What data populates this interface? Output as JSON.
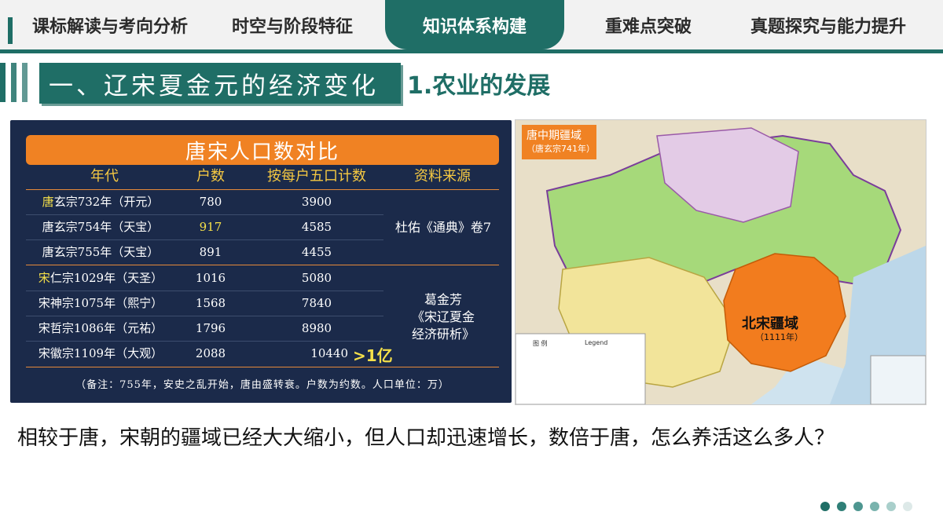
{
  "nav": {
    "tabs": [
      "课标解读与考向分析",
      "时空与阶段特征",
      "知识体系构建",
      "重难点突破",
      "真题探究与能力提升"
    ],
    "active_index": 2,
    "accent": "#1f6e66"
  },
  "section": {
    "heading": "一、辽宋夏金元的经济变化",
    "subheading": "1.农业的发展"
  },
  "table": {
    "title": "唐宋人口数对比",
    "headers": [
      "年代",
      "户数",
      "按每户五口计数",
      "资料来源"
    ],
    "rows": [
      {
        "era_prefix": "唐",
        "era_rest": "玄宗732年（开元）",
        "households": "780",
        "population": "3900"
      },
      {
        "era_prefix": "",
        "era_rest": "唐玄宗754年（天宝）",
        "households": "917",
        "population": "4585"
      },
      {
        "era_prefix": "",
        "era_rest": "唐玄宗755年（天宝）",
        "households": "891",
        "population": "4455"
      },
      {
        "era_prefix": "宋",
        "era_rest": "仁宗1029年（天圣）",
        "households": "1016",
        "population": "5080"
      },
      {
        "era_prefix": "",
        "era_rest": "宋神宗1075年（熙宁）",
        "households": "1568",
        "population": "7840"
      },
      {
        "era_prefix": "",
        "era_rest": "宋哲宗1086年（元祐）",
        "households": "1796",
        "population": "8980"
      },
      {
        "era_prefix": "",
        "era_rest": "宋徽宗1109年（大观）",
        "households": "2088",
        "population": "10440"
      }
    ],
    "source_tang": "杜佑《通典》卷7",
    "source_song": [
      "葛金芳",
      "《宋辽夏金",
      "经济研析》"
    ],
    "over_label": ">1亿",
    "note": "（备注：755年，安史之乱开始，唐由盛转衰。户数为约数。人口单位：万）"
  },
  "map": {
    "tang_label": "唐中期疆域",
    "tang_sub": "（唐玄宗741年）",
    "song_label": "北宋疆域",
    "song_sub": "（1111年）",
    "legend_title": "图 例",
    "legend_en": "Legend"
  },
  "question": "相较于唐，宋朝的疆域已经大大缩小，但人口却迅速增长，数倍于唐，怎么养活这么多人？",
  "pager_dots": [
    "#1f6e66",
    "#2f7f77",
    "#4e9690",
    "#79b3ad",
    "#a9cfcb",
    "#dde9e8"
  ]
}
